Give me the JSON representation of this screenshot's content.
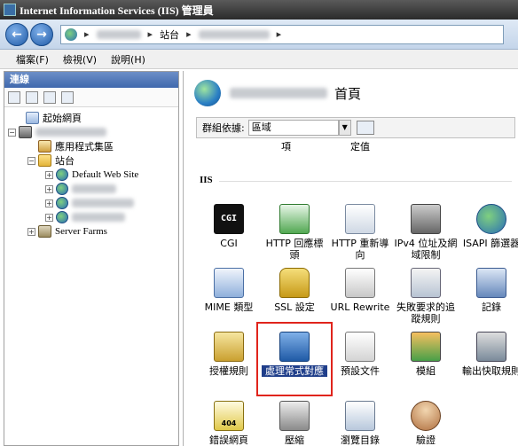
{
  "window": {
    "title": "Internet Information Services (IIS) 管理員"
  },
  "address": {
    "separator": "▸",
    "crumb_sites": "站台",
    "end_arrow": "▸"
  },
  "menu": {
    "file": "檔案(F)",
    "view": "檢視(V)",
    "help": "說明(H)"
  },
  "connections": {
    "header": "連線",
    "tree": {
      "start_page": "起始網頁",
      "app_pools": "應用程式集區",
      "sites": "站台",
      "default_site": "Default Web Site",
      "server_farms": "Server Farms"
    }
  },
  "main": {
    "title": "首頁",
    "group_label": "群組依據:",
    "group_value": "區域",
    "cut_row": [
      "項",
      "定值"
    ],
    "section": "IIS",
    "features": [
      {
        "label": "CGI",
        "icon": "cgi-icon",
        "icon_text": "CGI"
      },
      {
        "label": "HTTP 回應標頭",
        "icon": "http-response-headers-icon"
      },
      {
        "label": "HTTP 重新導向",
        "icon": "http-redirect-icon"
      },
      {
        "label": "IPv4 位址及網域限制",
        "icon": "ip-restrictions-icon"
      },
      {
        "label": "ISAPI 篩選器",
        "icon": "isapi-filters-icon"
      },
      {
        "label": "MIME 類型",
        "icon": "mime-types-icon"
      },
      {
        "label": "SSL 設定",
        "icon": "ssl-lock-icon"
      },
      {
        "label": "URL Rewrite",
        "icon": "url-rewrite-icon"
      },
      {
        "label": "失敗要求的追蹤規則",
        "icon": "failed-request-tracing-icon"
      },
      {
        "label": "記錄",
        "icon": "logging-icon"
      },
      {
        "label": "授權規則",
        "icon": "authorization-rules-icon"
      },
      {
        "label": "處理常式對應",
        "icon": "handler-mappings-icon"
      },
      {
        "label": "預設文件",
        "icon": "default-document-icon"
      },
      {
        "label": "模組",
        "icon": "modules-icon"
      },
      {
        "label": "輸出快取規則",
        "icon": "output-caching-icon"
      },
      {
        "label": "錯誤網頁",
        "icon": "error-pages-icon",
        "icon_text": "404"
      },
      {
        "label": "壓縮",
        "icon": "compression-icon"
      },
      {
        "label": "瀏覽目錄",
        "icon": "directory-browsing-icon"
      },
      {
        "label": "驗證",
        "icon": "authentication-icon"
      }
    ]
  }
}
